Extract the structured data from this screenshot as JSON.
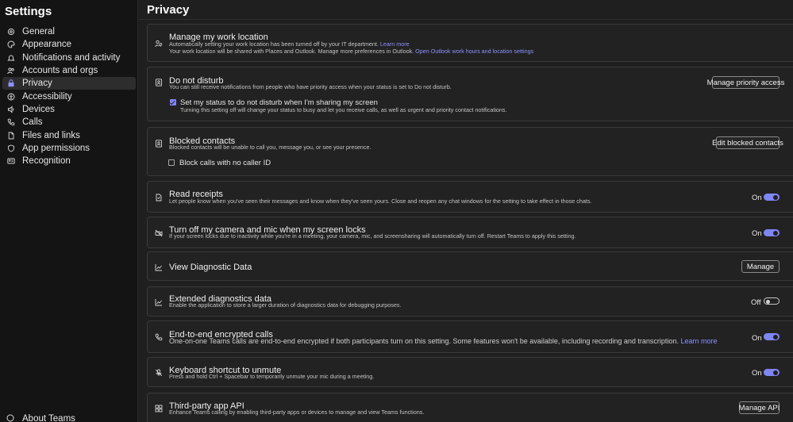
{
  "sidebar": {
    "title": "Settings",
    "items": [
      {
        "label": "General",
        "icon": "gear-icon"
      },
      {
        "label": "Appearance",
        "icon": "palette-icon"
      },
      {
        "label": "Notifications and activity",
        "icon": "bell-icon"
      },
      {
        "label": "Accounts and orgs",
        "icon": "people-icon"
      },
      {
        "label": "Privacy",
        "icon": "lock-icon",
        "active": true
      },
      {
        "label": "Accessibility",
        "icon": "accessibility-icon"
      },
      {
        "label": "Devices",
        "icon": "speaker-icon"
      },
      {
        "label": "Calls",
        "icon": "phone-icon"
      },
      {
        "label": "Files and links",
        "icon": "file-icon"
      },
      {
        "label": "App permissions",
        "icon": "shield-icon"
      },
      {
        "label": "Recognition",
        "icon": "id-card-icon"
      }
    ],
    "about": "About Teams"
  },
  "main": {
    "title": "Privacy",
    "accent_color": "#7f85f5",
    "work_location": {
      "title": "Manage my work location",
      "desc1": "Automatically setting your work location has been turned off by your IT department.",
      "desc1_link": "Learn more",
      "desc2": "Your work location will be shared with Places and Outlook. Manage more preferences in Outlook.",
      "desc2_link": "Open Outlook work hours and location settings"
    },
    "dnd": {
      "title": "Do not disturb",
      "desc": "You can still receive notifications from people who have priority access when your status is set to Do not disturb.",
      "button": "Manage priority access",
      "checkbox_label": "Set my status to do not disturb when I'm sharing my screen",
      "checkbox_desc": "Turning this setting off will change your status to busy and let you receive calls, as well as urgent and priority contact notifications.",
      "checkbox_checked": true
    },
    "blocked": {
      "title": "Blocked contacts",
      "desc": "Blocked contacts will be unable to call you, message you, or see your presence.",
      "button": "Edit blocked contacts",
      "checkbox_label": "Block calls with no caller ID",
      "checkbox_checked": false
    },
    "read_receipts": {
      "title": "Read receipts",
      "desc": "Let people know when you've seen their messages and know when they've seen yours. Close and reopen any chat windows for the setting to take effect in those chats.",
      "state": "On"
    },
    "camera_mic": {
      "title": "Turn off my camera and mic when my screen locks",
      "desc": "If your screen locks due to inactivity while you're in a meeting, your camera, mic, and screensharing will automatically turn off. Restart Teams to apply this setting.",
      "state": "On"
    },
    "diagnostic": {
      "title": "View Diagnostic Data",
      "button": "Manage"
    },
    "extended_diag": {
      "title": "Extended diagnostics data",
      "desc": "Enable the application to store a larger duration of diagnostics data for debugging purposes.",
      "state": "Off"
    },
    "e2e": {
      "title": "End-to-end encrypted calls",
      "desc": "One-on-one Teams calls are end-to-end encrypted if both participants turn on this setting. Some features won't be available, including recording and transcription.",
      "link": "Learn more",
      "state": "On"
    },
    "shortcut": {
      "title": "Keyboard shortcut to unmute",
      "desc": "Press and hold Ctrl + Spacebar to temporarily unmute your mic during a meeting.",
      "state": "On"
    },
    "thirdparty": {
      "title": "Third-party app API",
      "desc": "Enhance Teams calling by enabling third-party apps or devices to manage and view Teams functions.",
      "button": "Manage API"
    }
  }
}
